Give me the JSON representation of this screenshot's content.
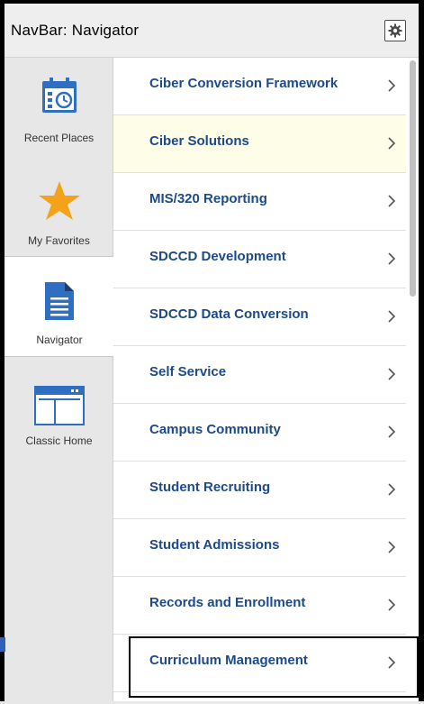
{
  "header": {
    "title": "NavBar: Navigator"
  },
  "icons": {
    "settings": "gear-icon"
  },
  "colors": {
    "accent_blue": "#2f6fc2",
    "star_orange": "#f4a21a",
    "link_blue": "#1c4a8a",
    "highlight": "#fdfde8"
  },
  "sidebar": {
    "items": [
      {
        "label": "Recent Places",
        "icon": "recent-places-icon"
      },
      {
        "label": "My Favorites",
        "icon": "star-icon"
      },
      {
        "label": "Navigator",
        "icon": "document-icon",
        "active": true
      },
      {
        "label": "Classic Home",
        "icon": "classic-home-icon"
      }
    ]
  },
  "menu": {
    "items": [
      {
        "label": "Ciber Conversion Framework"
      },
      {
        "label": "Ciber Solutions",
        "hovered": true
      },
      {
        "label": "MIS/320 Reporting"
      },
      {
        "label": "SDCCD Development"
      },
      {
        "label": "SDCCD Data Conversion"
      },
      {
        "label": "Self Service"
      },
      {
        "label": "Campus Community"
      },
      {
        "label": "Student Recruiting"
      },
      {
        "label": "Student Admissions"
      },
      {
        "label": "Records and Enrollment"
      },
      {
        "label": "Curriculum Management",
        "focused": true
      }
    ]
  }
}
